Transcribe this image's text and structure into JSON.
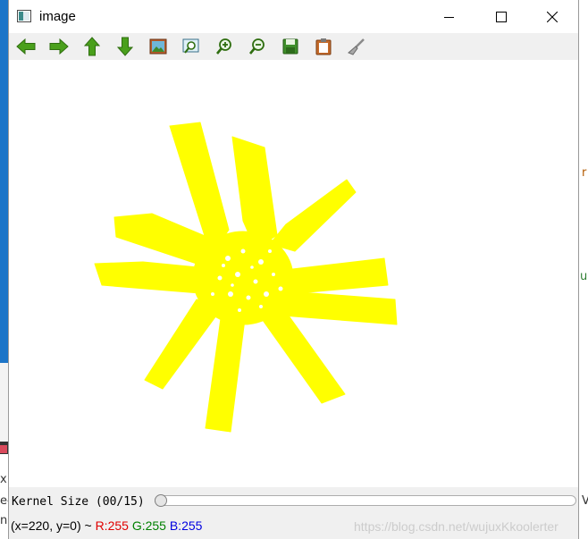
{
  "window": {
    "title": "image",
    "controls": [
      "minimize",
      "maximize",
      "close"
    ]
  },
  "toolbar": {
    "buttons": [
      {
        "name": "pan-left",
        "icon": "arrow-left-icon"
      },
      {
        "name": "pan-right",
        "icon": "arrow-right-icon"
      },
      {
        "name": "pan-up",
        "icon": "arrow-up-icon"
      },
      {
        "name": "pan-down",
        "icon": "arrow-down-icon"
      },
      {
        "name": "zoom-fit",
        "icon": "picture-icon"
      },
      {
        "name": "zoom-area",
        "icon": "zoom-area-icon"
      },
      {
        "name": "zoom-in",
        "icon": "zoom-in-icon"
      },
      {
        "name": "zoom-out",
        "icon": "zoom-out-icon"
      },
      {
        "name": "save",
        "icon": "save-icon"
      },
      {
        "name": "copy",
        "icon": "clipboard-icon"
      },
      {
        "name": "properties",
        "icon": "brush-icon"
      }
    ]
  },
  "image": {
    "description_color": "#ffff00",
    "background_color": "#ffffff"
  },
  "trackbar": {
    "label": "Kernel Size (00/15)",
    "value": 0,
    "max": 15
  },
  "status": {
    "coords": "(x=220, y=0) ~ ",
    "r": "R:255",
    "g": "G:255",
    "b": "B:255",
    "watermark": "https://blog.csdn.net/wujuxKkoolerter"
  },
  "background": {
    "frag_r1": "r",
    "frag_r2": "u",
    "frag_l1": "xF",
    "frag_l2": "e-",
    "frag_l3": "n",
    "frag_r3": "V"
  },
  "colors": {
    "accent_red": "#e00000",
    "accent_green": "#008000",
    "accent_blue": "#0000e0",
    "toolbar_bg": "#f0f0f0",
    "flower": "#ffff00"
  }
}
